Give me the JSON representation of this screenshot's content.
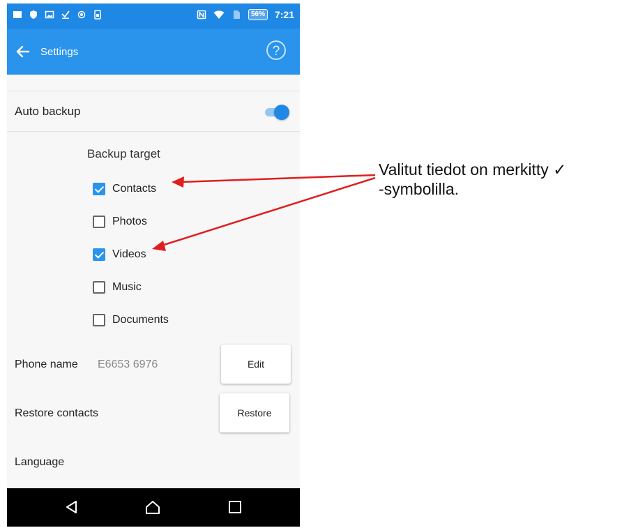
{
  "status_bar": {
    "battery": "56%",
    "time": "7:21",
    "left_icons": [
      "notification-icon",
      "shield-icon",
      "image-icon",
      "download-icon",
      "record-icon",
      "phone-icon"
    ],
    "right_icons": [
      "nfc-icon",
      "wifi-icon",
      "sim-icon"
    ]
  },
  "app_bar": {
    "title": "Settings",
    "help_label": "?",
    "color": "#2a93eb"
  },
  "settings": {
    "auto_backup": {
      "label": "Auto backup",
      "enabled": true
    },
    "backup_target": {
      "title": "Backup target",
      "items": [
        {
          "label": "Contacts",
          "checked": true
        },
        {
          "label": "Photos",
          "checked": false
        },
        {
          "label": "Videos",
          "checked": true
        },
        {
          "label": "Music",
          "checked": false
        },
        {
          "label": "Documents",
          "checked": false
        }
      ]
    },
    "phone_name": {
      "label": "Phone name",
      "value": "E6653 6976",
      "button": "Edit"
    },
    "restore_contacts": {
      "label": "Restore contacts",
      "button": "Restore"
    },
    "language": {
      "label": "Language"
    }
  },
  "nav_bar": {
    "buttons": [
      "back-icon",
      "home-icon",
      "recents-icon"
    ]
  },
  "annotation": {
    "line1": "Valitut tiedot on merkitty ✓",
    "line2": "-symbolilla.",
    "arrow_color": "#e01e1e"
  }
}
